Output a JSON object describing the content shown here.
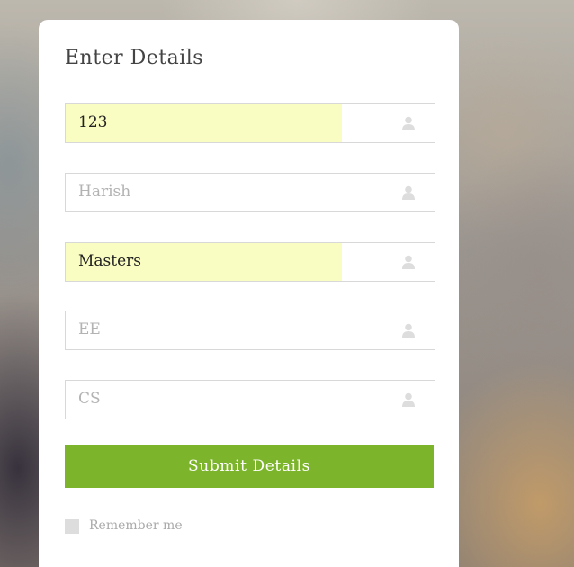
{
  "form": {
    "title": "Enter Details",
    "fields": [
      {
        "value": "123",
        "placeholder": "",
        "autofilled": true,
        "icon": "user-icon"
      },
      {
        "value": "",
        "placeholder": "Harish",
        "autofilled": false,
        "icon": "user-icon"
      },
      {
        "value": "Masters",
        "placeholder": "",
        "autofilled": true,
        "icon": "user-icon"
      },
      {
        "value": "",
        "placeholder": "EE",
        "autofilled": false,
        "icon": "user-icon"
      },
      {
        "value": "",
        "placeholder": "CS",
        "autofilled": false,
        "icon": "user-icon"
      }
    ],
    "submit_label": "Submit Details",
    "remember_label": "Remember me",
    "remember_checked": false
  },
  "colors": {
    "accent": "#7cb52b",
    "autofill": "#fafdc1",
    "card": "#ffffff",
    "placeholder": "#b3b3b3",
    "icon": "#dddddd"
  }
}
